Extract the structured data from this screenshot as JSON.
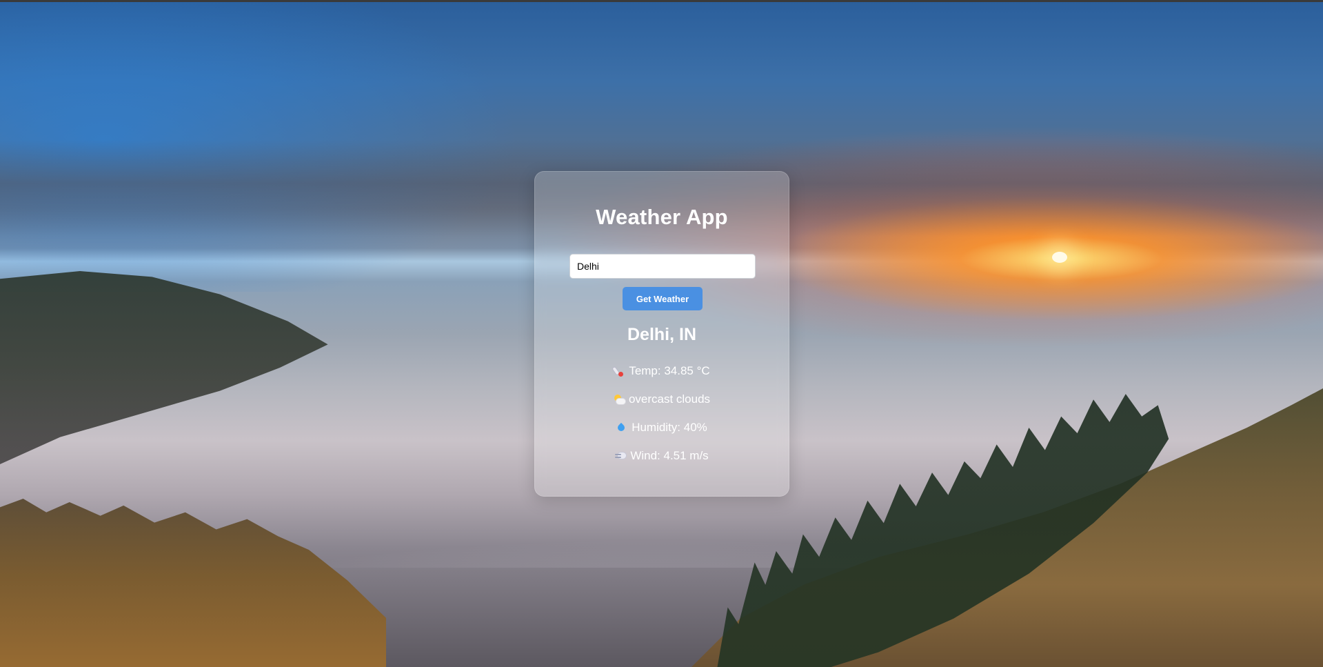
{
  "app": {
    "title": "Weather App"
  },
  "search": {
    "value": "Delhi",
    "button_label": "Get Weather"
  },
  "result": {
    "location": "Delhi, IN",
    "temperature": "Temp: 34.85 °C",
    "condition": "overcast clouds",
    "humidity": "Humidity: 40%",
    "wind": "Wind: 4.51 m/s"
  },
  "icons": {
    "temperature": "thermometer-icon",
    "condition": "sun-behind-cloud-icon",
    "humidity": "droplet-icon",
    "wind": "wind-icon"
  },
  "colors": {
    "button": "#4a90e2",
    "card_text": "#ffffff",
    "card_background": "rgba(255,255,255,0.22)"
  }
}
